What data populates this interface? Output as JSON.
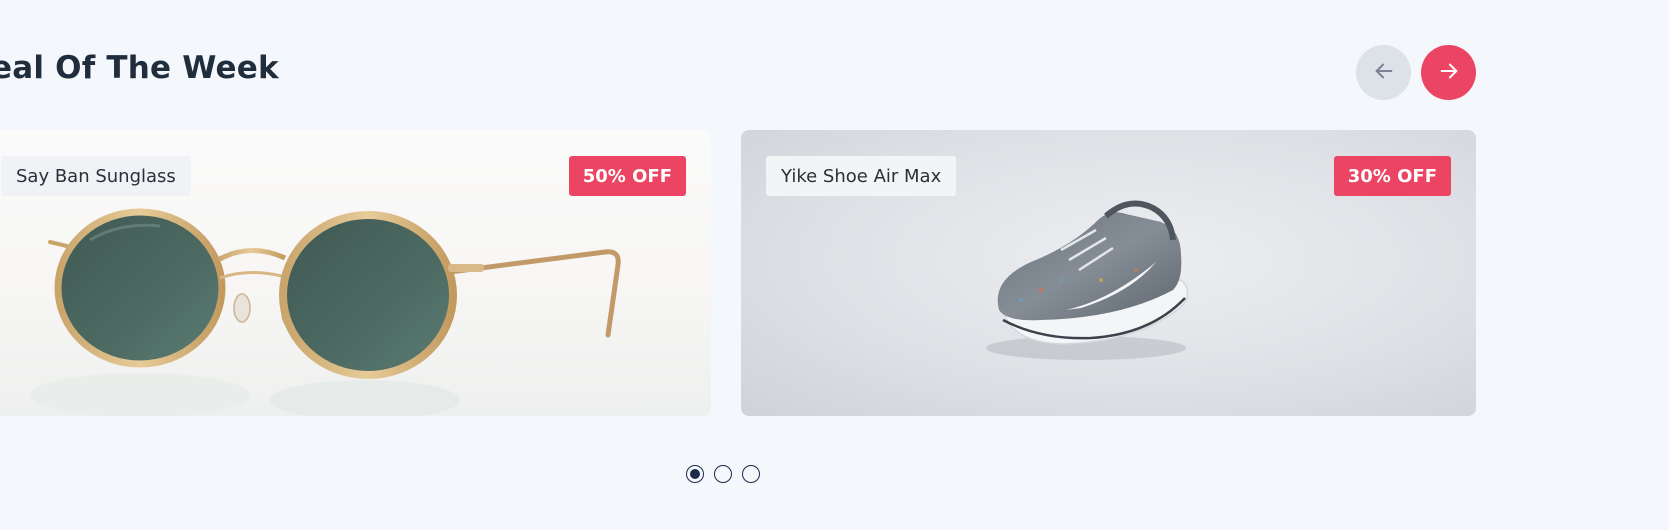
{
  "section": {
    "title": "eal Of The Week"
  },
  "navigation": {
    "prev_icon": "arrow-left-icon",
    "next_icon": "arrow-right-icon"
  },
  "cards": [
    {
      "name": "Say Ban Sunglass",
      "discount": "50% OFF",
      "image": "sunglasses-photo"
    },
    {
      "name": "Yike Shoe Air Max",
      "discount": "30% OFF",
      "image": "sneaker-photo"
    }
  ],
  "pagination": {
    "count": 3,
    "active_index": 0
  },
  "colors": {
    "background": "#f4f7fb",
    "accent": "#eb4563",
    "title": "#1f2d3d",
    "dot": "#1b2a4a",
    "prev_button": "#dde2e9"
  }
}
